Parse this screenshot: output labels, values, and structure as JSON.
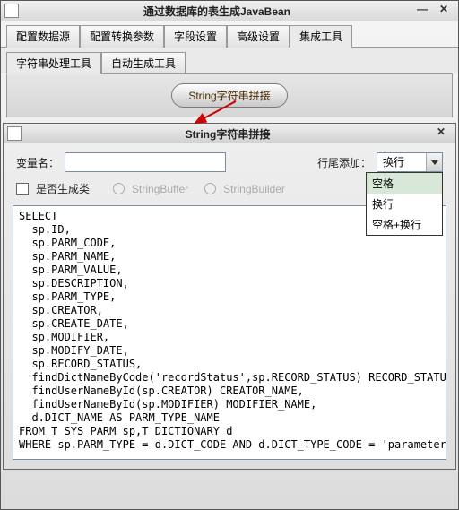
{
  "mainWindow": {
    "title": "通过数据库的表生成JavaBean"
  },
  "mainTabs": [
    "配置数据源",
    "配置转换参数",
    "字段设置",
    "高级设置",
    "集成工具"
  ],
  "mainTabActive": 4,
  "subTabs": [
    "字符串处理工具",
    "自动生成工具"
  ],
  "subTabActive": 0,
  "mainButton": "String字符串拼接",
  "dialog": {
    "title": "String字符串拼接",
    "varLabel": "变量名：",
    "varValue": "",
    "tailLabel": "行尾添加：",
    "tailValue": "换行",
    "tailOptions": [
      "空格",
      "换行",
      "空格+换行"
    ],
    "genClassLabel": "是否生成类",
    "radio1": "StringBuffer",
    "radio2": "StringBuilder",
    "code": "SELECT\n  sp.ID,\n  sp.PARM_CODE,\n  sp.PARM_NAME,\n  sp.PARM_VALUE,\n  sp.DESCRIPTION,\n  sp.PARM_TYPE,\n  sp.CREATOR,\n  sp.CREATE_DATE,\n  sp.MODIFIER,\n  sp.MODIFY_DATE,\n  sp.RECORD_STATUS,\n  findDictNameByCode('recordStatus',sp.RECORD_STATUS) RECORD_STATUS_NAME,\n  findUserNameById(sp.CREATOR) CREATOR_NAME,\n  findUserNameById(sp.MODIFIER) MODIFIER_NAME,\n  d.DICT_NAME AS PARM_TYPE_NAME\nFROM T_SYS_PARM sp,T_DICTIONARY d\nWHERE sp.PARM_TYPE = d.DICT_CODE AND d.DICT_TYPE_CODE = 'parameterType'"
  }
}
